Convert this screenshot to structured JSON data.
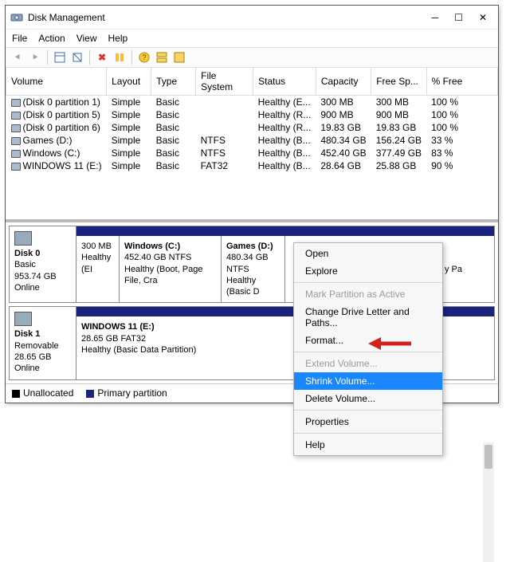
{
  "window": {
    "title": "Disk Management"
  },
  "menus": {
    "file": "File",
    "action": "Action",
    "view": "View",
    "help": "Help"
  },
  "columns": {
    "volume": "Volume",
    "layout": "Layout",
    "type": "Type",
    "fs": "File System",
    "status": "Status",
    "capacity": "Capacity",
    "free": "Free Sp...",
    "pct": "% Free"
  },
  "rows": [
    {
      "v": "(Disk 0 partition 1)",
      "l": "Simple",
      "t": "Basic",
      "fs": "",
      "s": "Healthy (E...",
      "c": "300 MB",
      "f": "300 MB",
      "p": "100 %"
    },
    {
      "v": "(Disk 0 partition 5)",
      "l": "Simple",
      "t": "Basic",
      "fs": "",
      "s": "Healthy (R...",
      "c": "900 MB",
      "f": "900 MB",
      "p": "100 %"
    },
    {
      "v": "(Disk 0 partition 6)",
      "l": "Simple",
      "t": "Basic",
      "fs": "",
      "s": "Healthy (R...",
      "c": "19.83 GB",
      "f": "19.83 GB",
      "p": "100 %"
    },
    {
      "v": "Games (D:)",
      "l": "Simple",
      "t": "Basic",
      "fs": "NTFS",
      "s": "Healthy (B...",
      "c": "480.34 GB",
      "f": "156.24 GB",
      "p": "33 %"
    },
    {
      "v": "Windows (C:)",
      "l": "Simple",
      "t": "Basic",
      "fs": "NTFS",
      "s": "Healthy (B...",
      "c": "452.40 GB",
      "f": "377.49 GB",
      "p": "83 %"
    },
    {
      "v": "WINDOWS 11 (E:)",
      "l": "Simple",
      "t": "Basic",
      "fs": "FAT32",
      "s": "Healthy (B...",
      "c": "28.64 GB",
      "f": "25.88 GB",
      "p": "90 %"
    }
  ],
  "disk0": {
    "name": "Disk 0",
    "type": "Basic",
    "size": "953.74 GB",
    "state": "Online",
    "p1": {
      "t1": "",
      "t2": "300 MB",
      "t3": "Healthy (EI"
    },
    "p2": {
      "t1": "Windows  (C:)",
      "t2": "452.40 GB NTFS",
      "t3": "Healthy (Boot, Page File, Cra"
    },
    "p3": {
      "t1": "Games  (D:)",
      "t2": "480.34 GB NTFS",
      "t3": "Healthy (Basic D"
    },
    "p4": {
      "t3": "y Pa"
    }
  },
  "disk1": {
    "name": "Disk 1",
    "type": "Removable",
    "size": "28.65 GB",
    "state": "Online",
    "p1": {
      "t1": "WINDOWS 11  (E:)",
      "t2": "28.65 GB FAT32",
      "t3": "Healthy (Basic Data Partition)"
    }
  },
  "legend": {
    "unalloc": "Unallocated",
    "primary": "Primary partition"
  },
  "ctx": {
    "open": "Open",
    "explore": "Explore",
    "mark": "Mark Partition as Active",
    "change": "Change Drive Letter and Paths...",
    "format": "Format...",
    "extend": "Extend Volume...",
    "shrink": "Shrink Volume...",
    "delete": "Delete Volume...",
    "props": "Properties",
    "help": "Help"
  },
  "colors": {
    "bar": "#1a237e",
    "hl": "#1a86ff",
    "arrow": "#d62020"
  }
}
